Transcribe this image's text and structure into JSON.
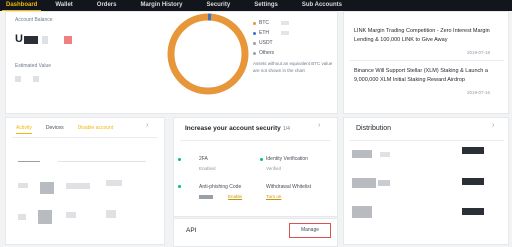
{
  "nav": {
    "items": [
      "Dashboard",
      "Wallet",
      "Orders",
      "Margin History",
      "Security",
      "Settings",
      "Sub Accounts"
    ],
    "active": "Dashboard"
  },
  "balance": {
    "account_label": "Account Balance",
    "account_value_prefix": "U",
    "estimated_label": "Estimated Value"
  },
  "donut": {
    "legend": [
      "BTC",
      "ETH",
      "USDT",
      "Others"
    ],
    "colors": {
      "main": "#e8963a",
      "accent": "#3a73c9"
    },
    "note": "Assets without an equivalent BTC value are not shown in the chart"
  },
  "news": [
    {
      "title": "LINK Margin Trading Competition - Zero Interest Margin Lending & 100,000 LINK to Give Away",
      "date": "2019-07-18"
    },
    {
      "title": "Binance Will Support Stellar (XLM) Staking & Launch a 9,000,000 XLM Initial Staking Reward Airdrop",
      "date": "2019-07-16"
    }
  ],
  "activity": {
    "tabs": [
      "Activity",
      "Devices",
      "Disable account"
    ]
  },
  "security": {
    "title": "Increase your account security",
    "count": "1/4",
    "items": [
      {
        "label": "2FA",
        "sub": "Enabled"
      },
      {
        "label": "Identity Verification",
        "sub": "Verified"
      },
      {
        "label": "Anti-phishing Code",
        "sub": "Disabled",
        "link": "Enable"
      },
      {
        "label": "Withdrawal Whitelist",
        "link": "Turn on"
      }
    ]
  },
  "api": {
    "title": "API",
    "manage_label": "Manage"
  },
  "distribution": {
    "title": "Distribution"
  },
  "icons": {
    "chevron": "chevron-right-icon"
  }
}
